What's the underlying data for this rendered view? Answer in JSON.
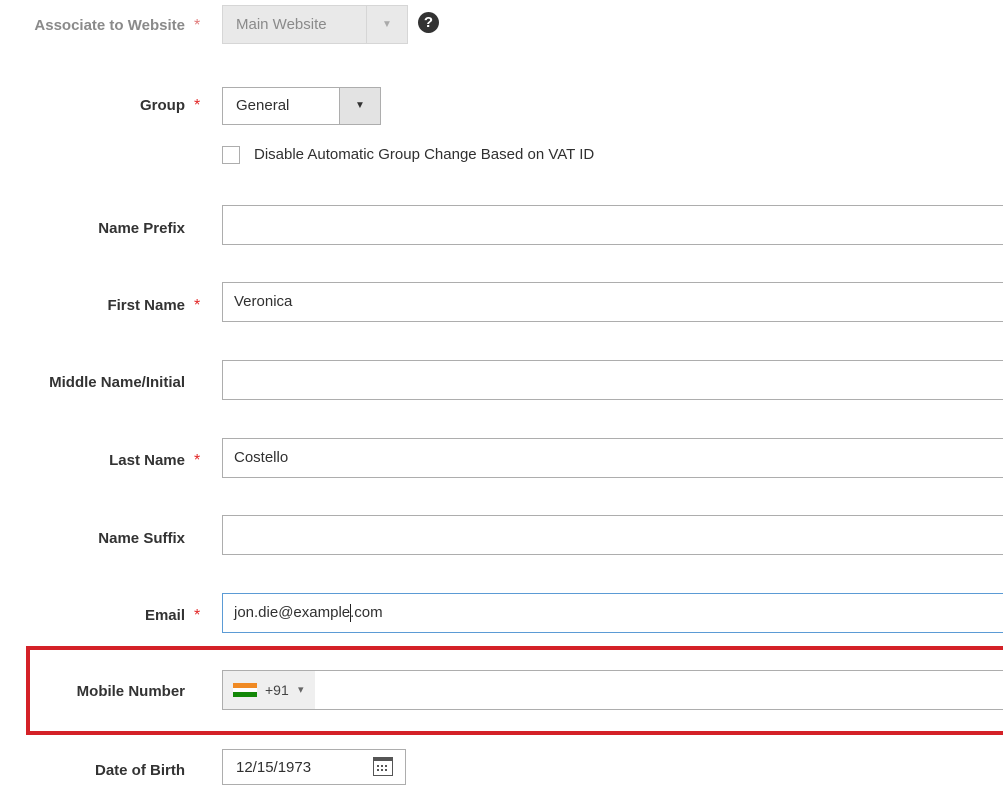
{
  "form": {
    "website": {
      "label": "Associate to Website",
      "required_mark": "*",
      "value": "Main Website",
      "arrow": "▼",
      "help_icon": "?"
    },
    "group": {
      "label": "Group",
      "required_mark": "*",
      "value": "General",
      "arrow": "▼"
    },
    "vat_checkbox": {
      "label": "Disable Automatic Group Change Based on VAT ID",
      "checked": false
    },
    "name_prefix": {
      "label": "Name Prefix",
      "value": ""
    },
    "first_name": {
      "label": "First Name",
      "required_mark": "*",
      "value": "Veronica"
    },
    "middle_name": {
      "label": "Middle Name/Initial",
      "value": ""
    },
    "last_name": {
      "label": "Last Name",
      "required_mark": "*",
      "value": "Costello"
    },
    "name_suffix": {
      "label": "Name Suffix",
      "value": ""
    },
    "email": {
      "label": "Email",
      "required_mark": "*",
      "value_before_cursor": "jon.die@example",
      "value_after_cursor": ".com"
    },
    "mobile": {
      "label": "Mobile Number",
      "country_code": "+91",
      "dropdown_arrow": "▾",
      "value": "",
      "flag_icon": "india-flag-icon"
    },
    "dob": {
      "label": "Date of Birth",
      "value": "12/15/1973",
      "icon": "calendar-icon"
    }
  },
  "colors": {
    "required": "#e22626",
    "highlight_border": "#d42127",
    "field_border": "#adadad",
    "focus_border": "#5b9bd5"
  }
}
